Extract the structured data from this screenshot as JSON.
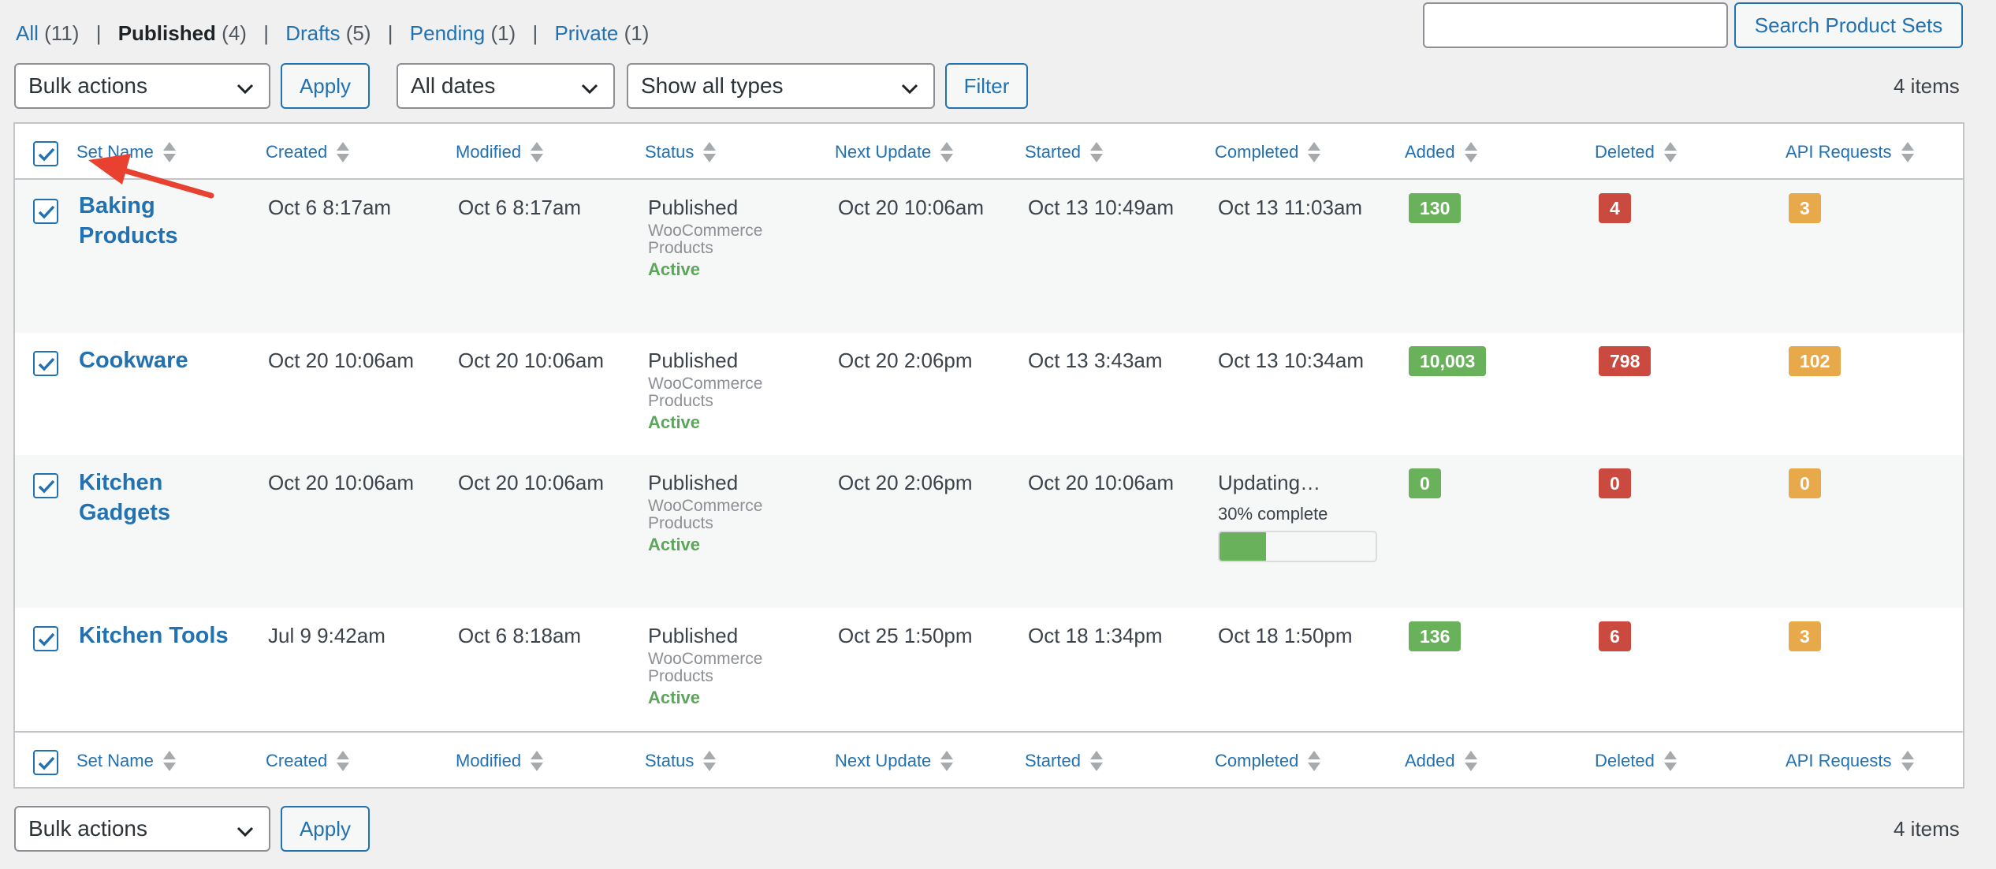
{
  "views": [
    {
      "label": "All",
      "count": "(11)"
    },
    {
      "label": "Published",
      "count": "(4)"
    },
    {
      "label": "Drafts",
      "count": "(5)"
    },
    {
      "label": "Pending",
      "count": "(1)"
    },
    {
      "label": "Private",
      "count": "(1)"
    }
  ],
  "search": {
    "value": "",
    "button": "Search Product Sets"
  },
  "top_nav": {
    "bulk_action": "Bulk actions",
    "apply": "Apply",
    "date_filter": "All dates",
    "type_filter": "Show all types",
    "filter": "Filter",
    "items": "4 items"
  },
  "bottom_nav": {
    "bulk_action": "Bulk actions",
    "apply": "Apply",
    "items": "4 items"
  },
  "columns": [
    "Set Name",
    "Created",
    "Modified",
    "Status",
    "Next Update",
    "Started",
    "Completed",
    "Added",
    "Deleted",
    "API Requests"
  ],
  "rows": [
    {
      "name": "Baking Products",
      "created": "Oct 6 8:17am",
      "modified": "Oct 6 8:17am",
      "status": "Published",
      "type": "WooCommerce Products",
      "state": "Active",
      "next_update": "Oct 20 10:06am",
      "started": "Oct 13 10:49am",
      "completed": "Oct 13 11:03am",
      "added": "130",
      "deleted": "4",
      "api_requests": "3"
    },
    {
      "name": "Cookware",
      "created": "Oct 20 10:06am",
      "modified": "Oct 20 10:06am",
      "status": "Published",
      "type": "WooCommerce Products",
      "state": "Active",
      "next_update": "Oct 20 2:06pm",
      "started": "Oct 13 3:43am",
      "completed": "Oct 13 10:34am",
      "added": "10,003",
      "deleted": "798",
      "api_requests": "102"
    },
    {
      "name": "Kitchen Gadgets",
      "created": "Oct 20 10:06am",
      "modified": "Oct 20 10:06am",
      "status": "Published",
      "type": "WooCommerce Products",
      "state": "Active",
      "next_update": "Oct 20 2:06pm",
      "started": "Oct 20 10:06am",
      "completed": "Updating…",
      "progress_label": "30% complete",
      "progress": 0.3,
      "added": "0",
      "deleted": "0",
      "api_requests": "0"
    },
    {
      "name": "Kitchen Tools",
      "created": "Jul 9 9:42am",
      "modified": "Oct 6 8:18am",
      "status": "Published",
      "type": "WooCommerce Products",
      "state": "Active",
      "next_update": "Oct 25 1:50pm",
      "started": "Oct 18 1:34pm",
      "completed": "Oct 18 1:50pm",
      "added": "136",
      "deleted": "6",
      "api_requests": "3"
    }
  ],
  "colors": {
    "accent": "#2271b1",
    "added": "#6ab15c",
    "deleted": "#ca4a40",
    "api": "#e8a94a",
    "active": "#5ba65b",
    "annotation_arrow": "#e8412f"
  }
}
